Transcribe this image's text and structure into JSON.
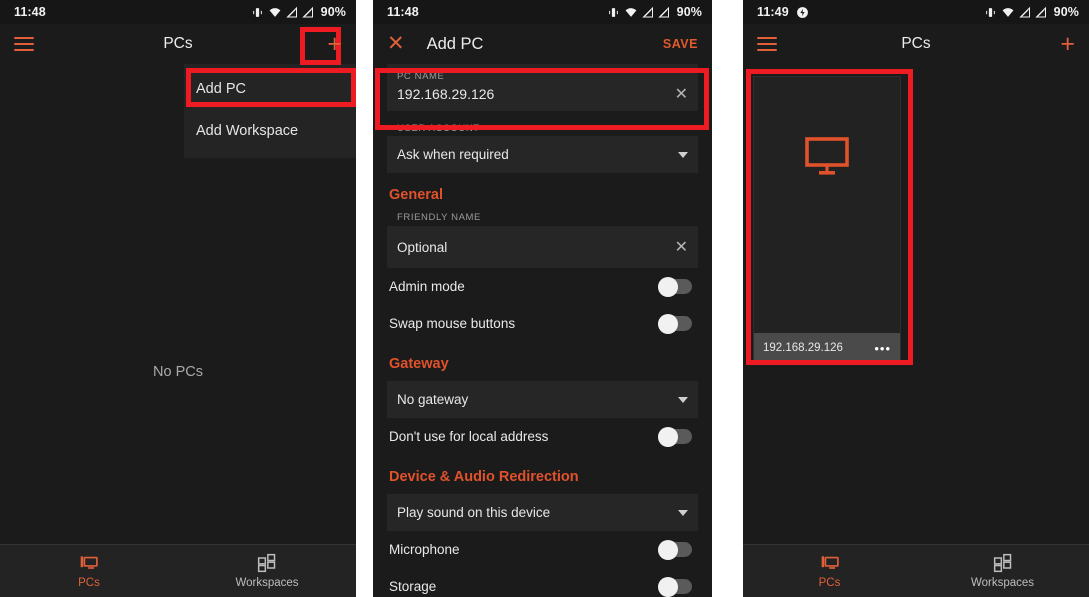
{
  "app": {
    "accent": "#e0603a",
    "accent_heading": "#e0522b",
    "annotation_color": "#ee1c22",
    "bg": "#1b1b1b"
  },
  "panel1": {
    "statusbar": {
      "clock": "11:48",
      "battery": "90%",
      "icons": [
        "vibrate-icon",
        "wifi-icon",
        "signal-off-icon",
        "signal-off-icon"
      ]
    },
    "appbar": {
      "menu_icon": "hamburger-icon",
      "title": "PCs",
      "add_icon": "plus-icon"
    },
    "menu": {
      "items": [
        "Add PC",
        "Add Workspace"
      ]
    },
    "empty_state": "No PCs",
    "bottomnav": [
      {
        "label": "PCs",
        "icon": "monitor-icon",
        "active": true
      },
      {
        "label": "Workspaces",
        "icon": "grid-icon",
        "active": false
      }
    ]
  },
  "panel2": {
    "statusbar": {
      "clock": "11:48",
      "battery": "90%"
    },
    "appbar": {
      "close_icon": "close-icon",
      "title": "Add PC",
      "save_label": "SAVE"
    },
    "pc_name": {
      "label": "PC NAME",
      "value": "192.168.29.126",
      "clear_icon": "clear-icon"
    },
    "user_account": {
      "label": "USER ACCOUNT",
      "value": "Ask when required"
    },
    "general": {
      "heading": "General",
      "friendly_name": {
        "label": "FRIENDLY NAME",
        "value": "",
        "placeholder": "Optional"
      },
      "toggles": [
        {
          "label": "Admin mode",
          "on": false
        },
        {
          "label": "Swap mouse buttons",
          "on": false
        }
      ]
    },
    "gateway": {
      "heading": "Gateway",
      "select_value": "No gateway",
      "toggles": [
        {
          "label": "Don't use for local address",
          "on": false
        }
      ]
    },
    "redirection": {
      "heading": "Device & Audio Redirection",
      "select_value": "Play sound on this device",
      "toggles": [
        {
          "label": "Microphone",
          "on": false
        },
        {
          "label": "Storage",
          "on": false
        }
      ]
    }
  },
  "panel3": {
    "statusbar": {
      "clock": "11:49",
      "battery": "90%",
      "notification_icon": "do-not-disturb-icon"
    },
    "appbar": {
      "menu_icon": "hamburger-icon",
      "title": "PCs",
      "add_icon": "plus-icon"
    },
    "pc_card": {
      "name": "192.168.29.126",
      "thumb_icon": "monitor-icon",
      "overflow_icon": "more-options-icon"
    },
    "bottomnav": [
      {
        "label": "PCs",
        "icon": "monitor-icon",
        "active": true
      },
      {
        "label": "Workspaces",
        "icon": "grid-icon",
        "active": false
      }
    ]
  }
}
